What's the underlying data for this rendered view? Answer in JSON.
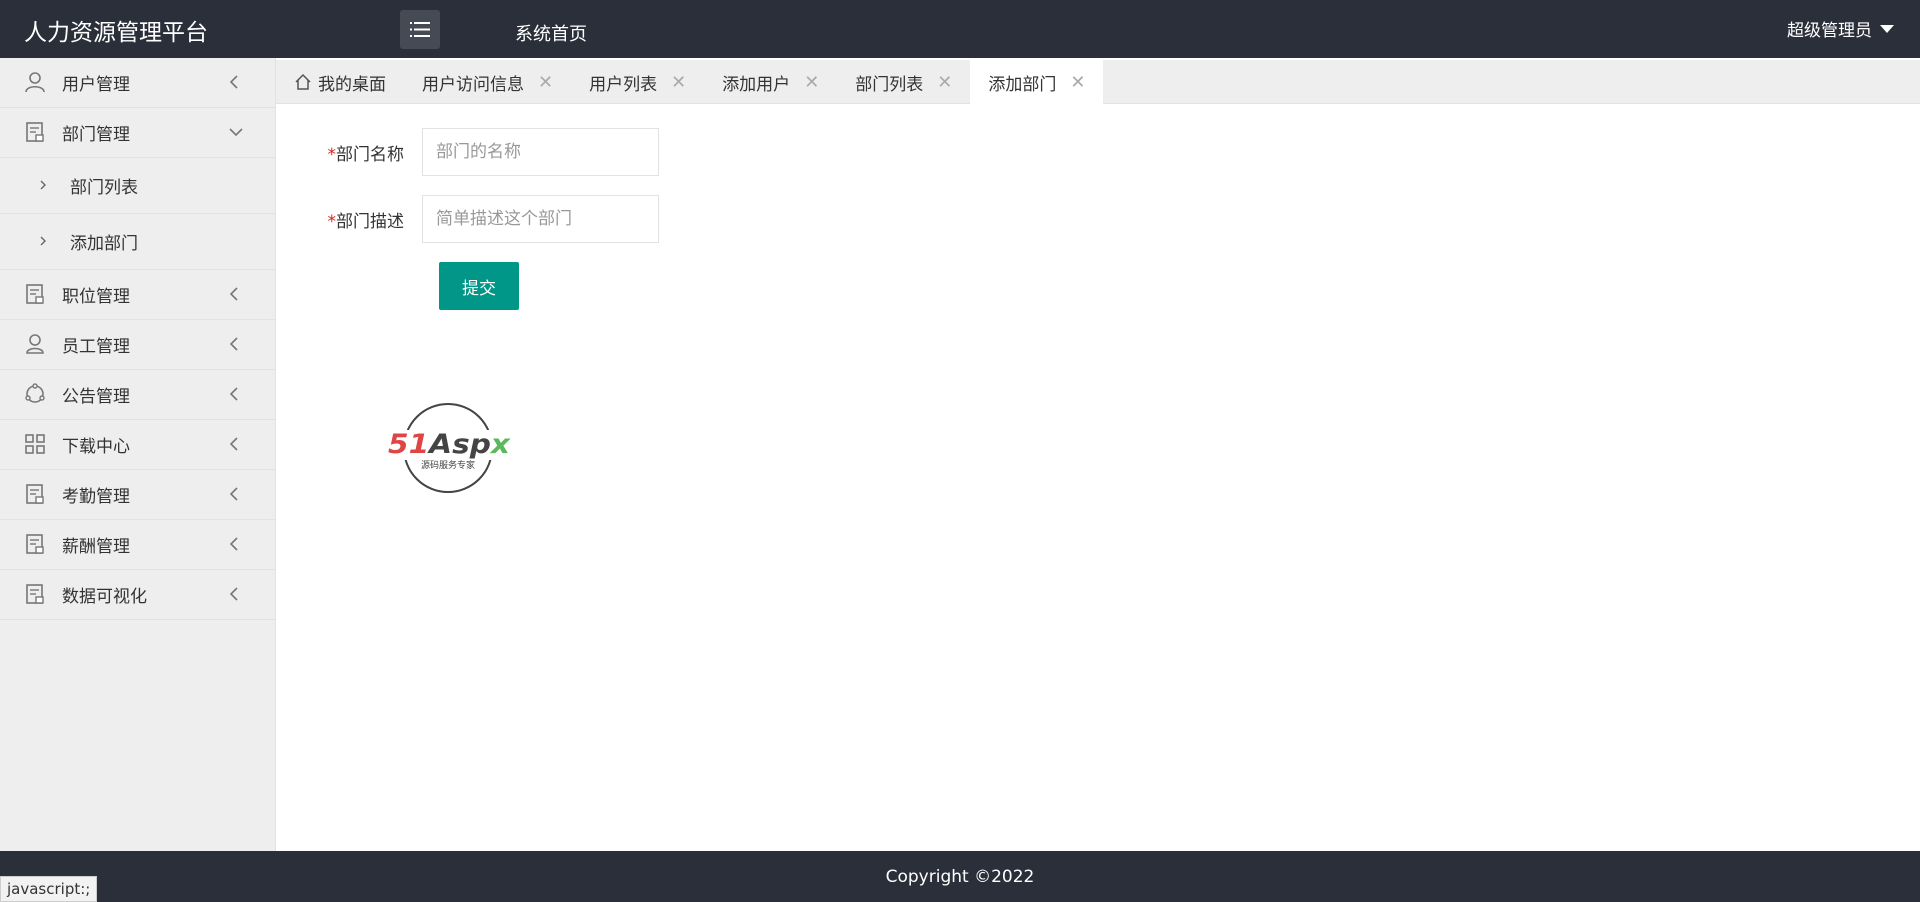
{
  "header": {
    "logo": "人力资源管理平台",
    "home_link": "系统首页",
    "user": "超级管理员"
  },
  "sidebar": {
    "items": [
      {
        "label": "用户管理",
        "icon": "user-icon"
      },
      {
        "label": "部门管理",
        "icon": "document-icon",
        "expanded": true
      },
      {
        "label": "职位管理",
        "icon": "document-icon"
      },
      {
        "label": "员工管理",
        "icon": "person-icon"
      },
      {
        "label": "公告管理",
        "icon": "share-icon"
      },
      {
        "label": "下载中心",
        "icon": "grid-icon"
      },
      {
        "label": "考勤管理",
        "icon": "document-icon"
      },
      {
        "label": "薪酬管理",
        "icon": "document-icon"
      },
      {
        "label": "数据可视化",
        "icon": "document-icon"
      }
    ],
    "sub_items": [
      {
        "label": "部门列表"
      },
      {
        "label": "添加部门"
      }
    ]
  },
  "tabs": [
    {
      "label": "我的桌面"
    },
    {
      "label": "用户访问信息"
    },
    {
      "label": "用户列表"
    },
    {
      "label": "添加用户"
    },
    {
      "label": "部门列表"
    },
    {
      "label": "添加部门",
      "active": true
    }
  ],
  "form": {
    "required_mark": "*",
    "name_label": "部门名称",
    "name_placeholder": "部门的名称",
    "desc_label": "部门描述",
    "desc_placeholder": "简单描述这个部门",
    "submit": "提交"
  },
  "watermark": {
    "brand": "51Aspx",
    "tagline": "源码服务专家"
  },
  "footer": {
    "copyright": "Copyright ©2022"
  },
  "statusbar": "javascript:;",
  "colors": {
    "header_bg": "#2b2f3a",
    "accent": "#009688",
    "required": "#e02020"
  }
}
